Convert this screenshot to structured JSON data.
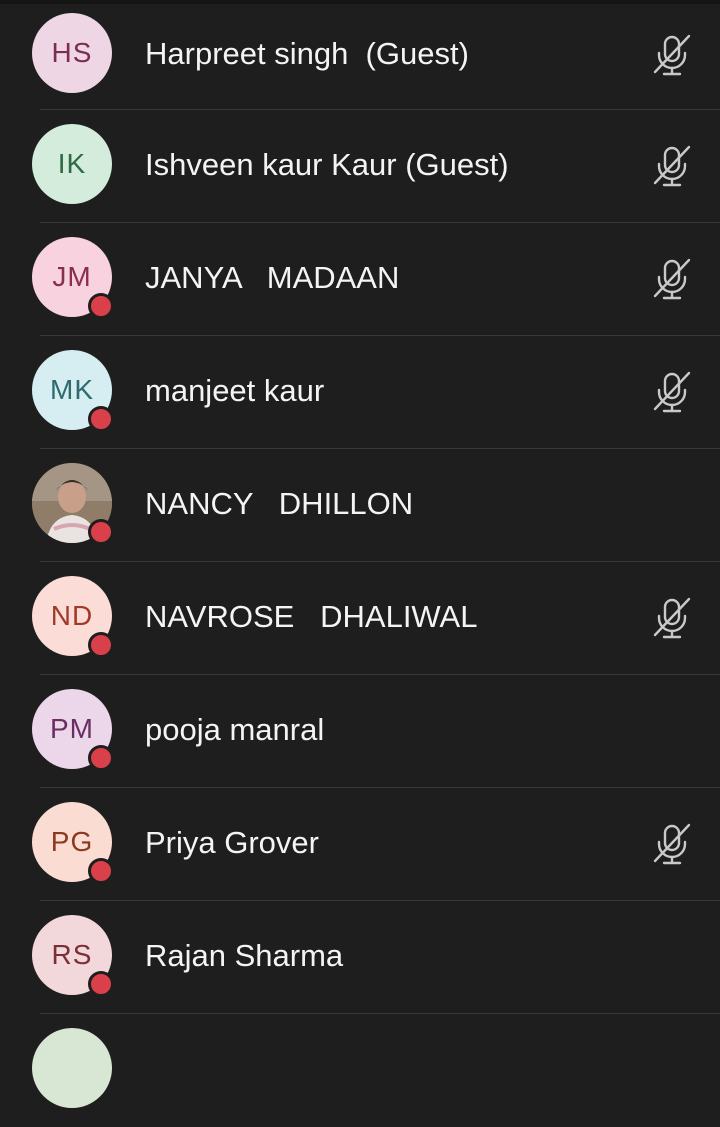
{
  "participants": [
    {
      "initials": "HS",
      "name": "Harpreet singh  (Guest)",
      "avatar_bg": "#efd6e4",
      "avatar_fg": "#7a2e55",
      "muted": true,
      "status_dot": false,
      "photo": false
    },
    {
      "initials": "IK",
      "name": "Ishveen kaur Kaur (Guest)",
      "avatar_bg": "#d3ecdc",
      "avatar_fg": "#2e6b45",
      "muted": true,
      "status_dot": false,
      "photo": false
    },
    {
      "initials": "JM",
      "name": "JANYA   MADAAN",
      "avatar_bg": "#f8d2de",
      "avatar_fg": "#8a2f4b",
      "muted": true,
      "status_dot": true,
      "photo": false
    },
    {
      "initials": "MK",
      "name": "manjeet kaur",
      "avatar_bg": "#d6eef1",
      "avatar_fg": "#2f6a70",
      "muted": true,
      "status_dot": true,
      "photo": false
    },
    {
      "initials": "",
      "name": "NANCY   DHILLON",
      "avatar_bg": "#8a7a6a",
      "avatar_fg": "#ffffff",
      "muted": false,
      "status_dot": true,
      "photo": true
    },
    {
      "initials": "ND",
      "name": "NAVROSE   DHALIWAL",
      "avatar_bg": "#fbdcd6",
      "avatar_fg": "#a03a2a",
      "muted": true,
      "status_dot": true,
      "photo": false
    },
    {
      "initials": "PM",
      "name": "pooja manral",
      "avatar_bg": "#ecd6ea",
      "avatar_fg": "#6a2e62",
      "muted": false,
      "status_dot": true,
      "photo": false
    },
    {
      "initials": "PG",
      "name": "Priya Grover",
      "avatar_bg": "#fbdcd2",
      "avatar_fg": "#8a3a20",
      "muted": true,
      "status_dot": true,
      "photo": false
    },
    {
      "initials": "RS",
      "name": "Rajan Sharma",
      "avatar_bg": "#f2d8da",
      "avatar_fg": "#7a3038",
      "muted": false,
      "status_dot": true,
      "photo": false
    },
    {
      "initials": "",
      "name": "",
      "avatar_bg": "#d8e6d4",
      "avatar_fg": "#3a5a34",
      "muted": false,
      "status_dot": false,
      "photo": false
    }
  ],
  "icons": {
    "mic_off": "microphone-off-icon",
    "status": "status-dot"
  },
  "colors": {
    "background": "#1f1e1e",
    "divider": "#3a3939",
    "status_dot": "#d9404a",
    "mic_icon": "#c9c9c9"
  }
}
